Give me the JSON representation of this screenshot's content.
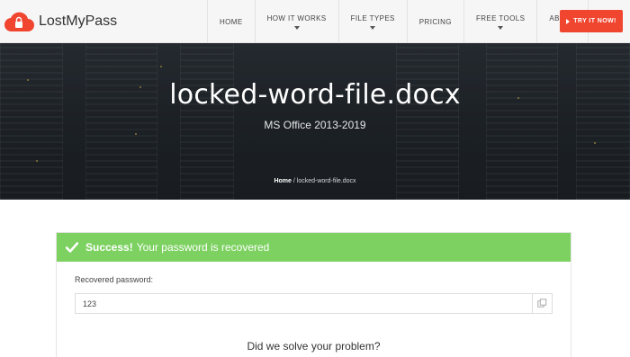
{
  "brand": {
    "name": "LostMyPass",
    "accent": "#f0452f"
  },
  "nav": {
    "items": [
      {
        "label": "HOME",
        "caret": false
      },
      {
        "label": "HOW IT WORKS",
        "caret": true
      },
      {
        "label": "FILE TYPES",
        "caret": true
      },
      {
        "label": "PRICING",
        "caret": false
      },
      {
        "label": "FREE TOOLS",
        "caret": true
      },
      {
        "label": "ABOUT",
        "caret": true
      }
    ],
    "cta_label": "TRY IT NOW!"
  },
  "hero": {
    "title": "locked-word-file.docx",
    "subtitle": "MS Office 2013-2019",
    "breadcrumb": {
      "home": "Home",
      "separator": " / ",
      "current": "locked-word-file.docx"
    }
  },
  "result": {
    "status_strong": "Success!",
    "status_text": "Your password is recovered",
    "status_color": "#7cd160",
    "field_label": "Recovered password:",
    "password": "123",
    "question": "Did we solve your problem?"
  }
}
